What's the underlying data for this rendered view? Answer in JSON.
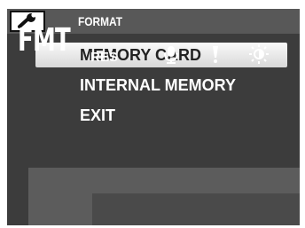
{
  "header": {
    "settings_icon": "wrench-icon"
  },
  "menu": {
    "items": [
      {
        "label": "MEMORY CARD",
        "selected": true
      },
      {
        "label": "INTERNAL MEMORY",
        "selected": false
      },
      {
        "label": "EXIT",
        "selected": false
      }
    ]
  },
  "footer": {
    "mode_label": "FMT",
    "description": "FORMAT",
    "tabs": [
      {
        "label": "RES"
      },
      {
        "icon": "microphone-icon"
      },
      {
        "icon": "exclamation-icon"
      },
      {
        "icon": "brightness-icon"
      }
    ]
  },
  "colors": {
    "background": "#3c3c3c",
    "highlight": "#e8e8e8",
    "text": "#ffffff"
  }
}
